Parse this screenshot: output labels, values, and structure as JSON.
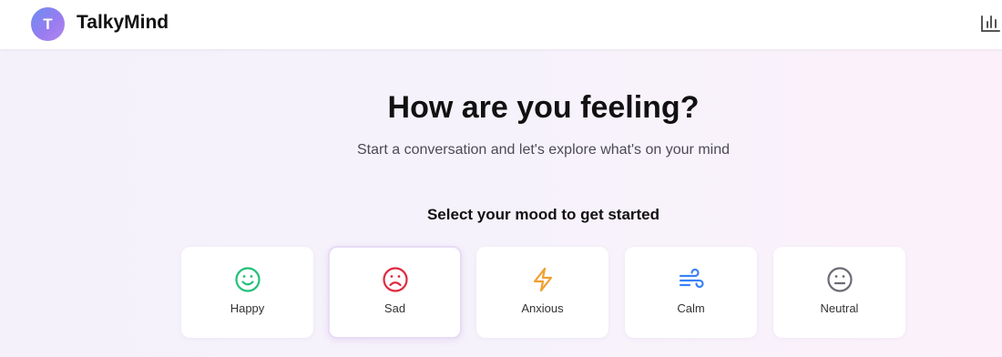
{
  "app": {
    "avatar_letter": "T",
    "title": "TalkyMind"
  },
  "header": {
    "stats_icon": "bar-chart-icon"
  },
  "main": {
    "title": "How are you feeling?",
    "subtitle": "Start a conversation and let's explore what's on your mind",
    "mood_prompt": "Select your mood to get started"
  },
  "moods": [
    {
      "label": "Happy",
      "icon": "smile-icon",
      "color": "#22c07a",
      "selected": false
    },
    {
      "label": "Sad",
      "icon": "frown-icon",
      "color": "#e0283e",
      "selected": true
    },
    {
      "label": "Anxious",
      "icon": "lightning-icon",
      "color": "#f0a030",
      "selected": false
    },
    {
      "label": "Calm",
      "icon": "wind-icon",
      "color": "#3b82f6",
      "selected": false
    },
    {
      "label": "Neutral",
      "icon": "neutral-face-icon",
      "color": "#6b6b74",
      "selected": false
    }
  ]
}
